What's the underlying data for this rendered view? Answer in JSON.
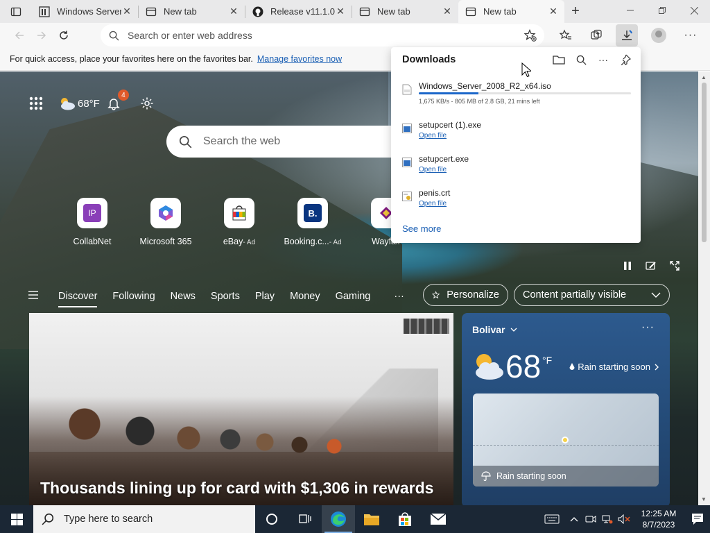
{
  "tabs": [
    {
      "title": "Windows Server",
      "favicon": "windows-server-favicon",
      "active": false
    },
    {
      "title": "New tab",
      "favicon": "newtab-favicon",
      "active": false
    },
    {
      "title": "Release v11.1.0",
      "favicon": "github-favicon",
      "active": false
    },
    {
      "title": "New tab",
      "favicon": "newtab-favicon",
      "active": false
    },
    {
      "title": "New tab",
      "favicon": "newtab-favicon",
      "active": true
    }
  ],
  "toolbar": {
    "address_placeholder": "Search or enter web address"
  },
  "favbar": {
    "message": "For quick access, place your favorites here on the favorites bar.",
    "link": "Manage favorites now"
  },
  "newtab": {
    "weather_temp": "68°F",
    "notification_count": "4",
    "search_placeholder": "Search the web",
    "quick_links": [
      {
        "label": "CollabNet",
        "ad": ""
      },
      {
        "label": "Microsoft 365",
        "ad": ""
      },
      {
        "label": "eBay",
        "ad": "- Ad"
      },
      {
        "label": "Booking.c...",
        "ad": "- Ad"
      },
      {
        "label": "Wayfair",
        "ad": ""
      }
    ],
    "feed_nav": [
      "Discover",
      "Following",
      "News",
      "Sports",
      "Play",
      "Money",
      "Gaming"
    ],
    "more": "···",
    "personalize": "Personalize",
    "content_visibility": "Content partially visible",
    "headline": "Thousands lining up for card with $1,306 in rewards",
    "weather": {
      "location": "Bolivar",
      "temp": "68",
      "unit": "°F",
      "condition": "Rain starting soon",
      "map_caption": "Rain starting soon"
    }
  },
  "downloads": {
    "title": "Downloads",
    "items": [
      {
        "name": "Windows_Server_2008_R2_x64.iso",
        "status": "1,675 KB/s - 805 MB of 2.8 GB, 21 mins left",
        "progress": 0.28,
        "in_progress": true
      },
      {
        "name": "setupcert (1).exe",
        "action": "Open file"
      },
      {
        "name": "setupcert.exe",
        "action": "Open file"
      },
      {
        "name": "penis.crt",
        "action": "Open file"
      }
    ],
    "see_more": "See more"
  },
  "taskbar": {
    "search_placeholder": "Type here to search",
    "time": "12:25 AM",
    "date": "8/7/2023"
  },
  "colors": {
    "accent": "#1a66c9",
    "link": "#1a5fb4",
    "taskbar": "#1b2735",
    "weather_card": "#2d5a8e"
  }
}
